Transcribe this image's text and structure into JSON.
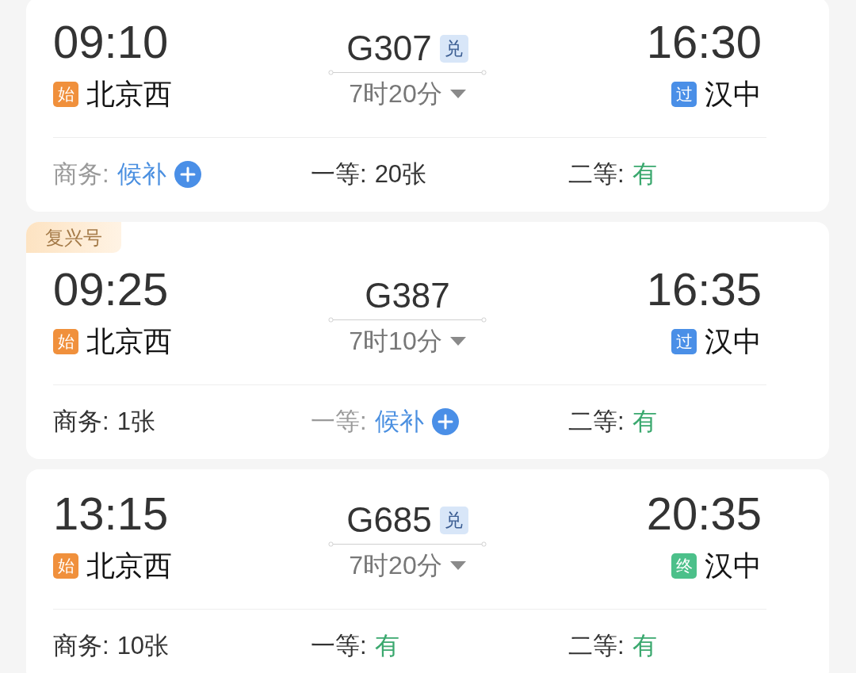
{
  "trains": [
    {
      "depart_time": "09:10",
      "from": {
        "badge": "始",
        "kind": "start",
        "name": "北京西"
      },
      "train_no": "G307",
      "exchange_badge": "兑",
      "duration": "7时20分",
      "arrive_time": "16:30",
      "to": {
        "badge": "过",
        "kind": "pass",
        "name": "汉中"
      },
      "seats": [
        {
          "label": "商务:",
          "value": "候补",
          "kind": "waitlist"
        },
        {
          "label": "一等:",
          "value": "20张",
          "kind": "count"
        },
        {
          "label": "二等:",
          "value": "有",
          "kind": "available"
        }
      ]
    },
    {
      "tag": "复兴号",
      "depart_time": "09:25",
      "from": {
        "badge": "始",
        "kind": "start",
        "name": "北京西"
      },
      "train_no": "G387",
      "duration": "7时10分",
      "arrive_time": "16:35",
      "to": {
        "badge": "过",
        "kind": "pass",
        "name": "汉中"
      },
      "seats": [
        {
          "label": "商务:",
          "value": "1张",
          "kind": "count"
        },
        {
          "label": "一等:",
          "value": "候补",
          "kind": "waitlist"
        },
        {
          "label": "二等:",
          "value": "有",
          "kind": "available"
        }
      ]
    },
    {
      "depart_time": "13:15",
      "from": {
        "badge": "始",
        "kind": "start",
        "name": "北京西"
      },
      "train_no": "G685",
      "exchange_badge": "兑",
      "duration": "7时20分",
      "arrive_time": "20:35",
      "to": {
        "badge": "终",
        "kind": "end",
        "name": "汉中"
      },
      "seats": [
        {
          "label": "商务:",
          "value": "10张",
          "kind": "count"
        },
        {
          "label": "一等:",
          "value": "有",
          "kind": "available"
        },
        {
          "label": "二等:",
          "value": "有",
          "kind": "available"
        }
      ]
    }
  ]
}
